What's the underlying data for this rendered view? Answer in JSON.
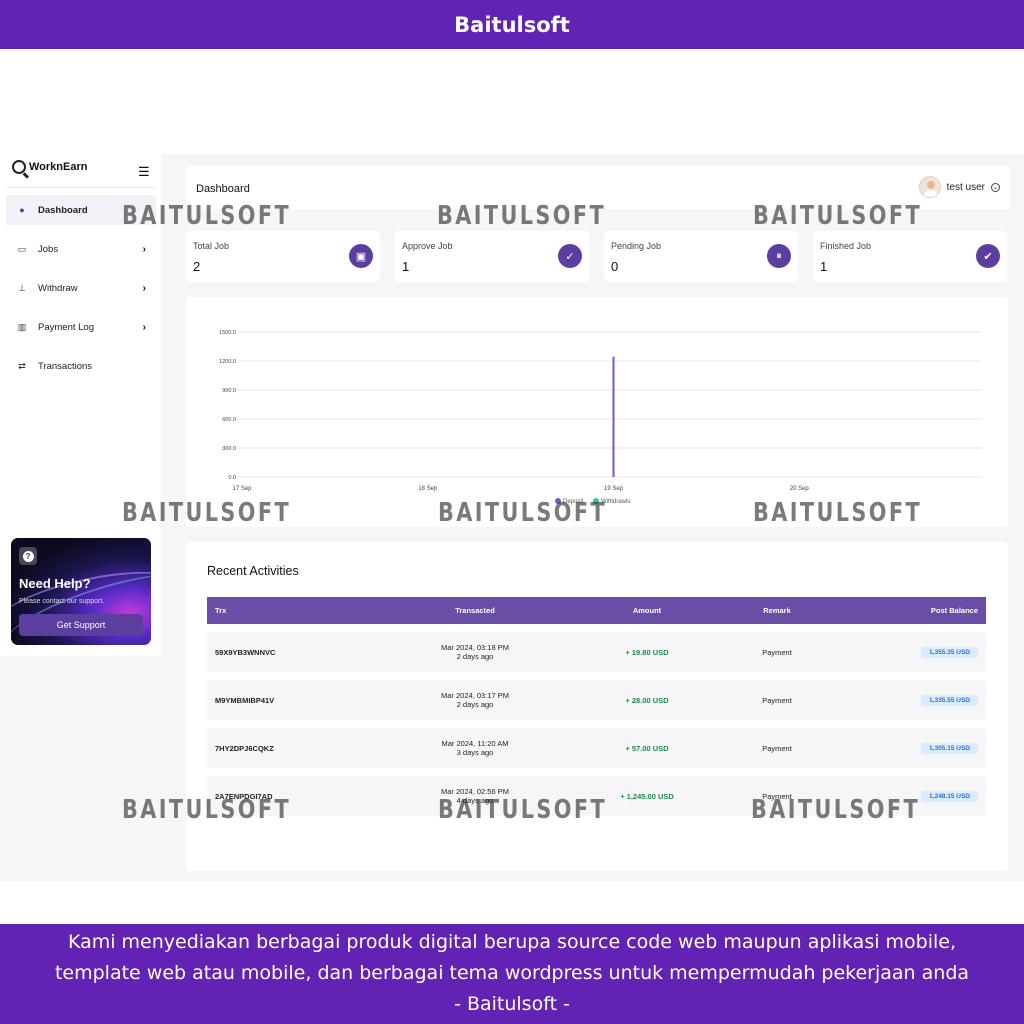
{
  "banner": {
    "top_title": "Baitulsoft",
    "bottom_lines": [
      "Kami menyediakan berbagai produk digital berupa source code web maupun aplikasi mobile,",
      "template web atau mobile, dan berbagai tema wordpress untuk mempermudah pekerjaan anda",
      "- Baitulsoft -"
    ]
  },
  "watermark": "BAITULSOFT",
  "sidebar": {
    "brand": "WorknEarn",
    "items": [
      {
        "label": "Dashboard",
        "icon": "user-icon"
      },
      {
        "label": "Jobs",
        "icon": "briefcase-icon"
      },
      {
        "label": "Withdraw",
        "icon": "withdraw-icon"
      },
      {
        "label": "Payment Log",
        "icon": "receipt-icon"
      },
      {
        "label": "Transactions",
        "icon": "swap-icon"
      }
    ]
  },
  "help": {
    "title": "Need Help?",
    "subtitle": "Please contact our support.",
    "button": "Get Support"
  },
  "header": {
    "title": "Dashboard",
    "user": "test user"
  },
  "stats": [
    {
      "label": "Total Job",
      "value": "2",
      "icon": "toolbox-icon"
    },
    {
      "label": "Approve Job",
      "value": "1",
      "icon": "check-circle-icon"
    },
    {
      "label": "Pending Job",
      "value": "0",
      "icon": "pause-icon"
    },
    {
      "label": "Finished Job",
      "value": "1",
      "icon": "double-check-icon"
    }
  ],
  "chart_data": {
    "type": "bar",
    "categories": [
      "17 Sep",
      "18 Sep",
      "19 Sep",
      "20 Sep"
    ],
    "series": [
      {
        "name": "Deposit",
        "values": [
          0,
          0,
          1245,
          0
        ],
        "color": "#7b52d9"
      },
      {
        "name": "Withdrawls",
        "values": [
          0,
          0,
          0,
          0
        ],
        "color": "#2ec7a0"
      }
    ],
    "y_ticks": [
      "1500.0",
      "1200.0",
      "900.0",
      "600.0",
      "300.0",
      "0.0"
    ],
    "ylim": [
      0,
      1500
    ],
    "grid": true,
    "legend": "bottom"
  },
  "activities": {
    "title": "Recent Activities",
    "columns": [
      "Trx",
      "Transacted",
      "Amount",
      "Remark",
      "Post Balance"
    ],
    "rows": [
      {
        "trx": "59X9YB3WNNVC",
        "date": "Mar 2024, 03:18 PM",
        "ago": "2 days ago",
        "amount": "+ 19.80 USD",
        "remark": "Payment",
        "balance": "1,355.35 USD"
      },
      {
        "trx": "M9YMBMIBP41V",
        "date": "Mar 2024, 03:17 PM",
        "ago": "2 days ago",
        "amount": "+ 28.00 USD",
        "remark": "Payment",
        "balance": "1,335.55 USD"
      },
      {
        "trx": "7HY2DPJ6CQKZ",
        "date": "Mar 2024, 11:20 AM",
        "ago": "3 days ago",
        "amount": "+ 57.00 USD",
        "remark": "Payment",
        "balance": "1,305.15 USD"
      },
      {
        "trx": "2A7ENPDGI7AD",
        "date": "Mar 2024, 02:56 PM",
        "ago": "4 days ago",
        "amount": "+ 1,245.00 USD",
        "remark": "Payment",
        "balance": "1,248.15 USD"
      }
    ]
  }
}
